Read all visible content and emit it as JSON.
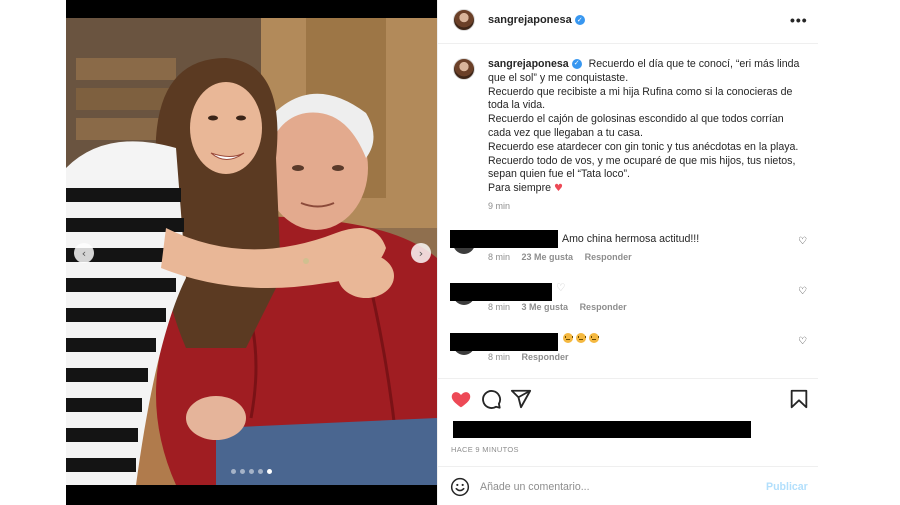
{
  "post": {
    "username": "sangrejaponesa",
    "verified_icon": "verified-badge-icon",
    "more_icon": "more-options-icon",
    "carousel": {
      "slide_count": 5,
      "active_slide": 5
    }
  },
  "caption": {
    "username": "sangrejaponesa",
    "lines": [
      "Recuerdo el día que te conocí, “eri más linda que el sol” y me conquistaste.",
      "Recuerdo que recibiste a mi hija Rufina como si la conocieras de toda la vida.",
      "Recuerdo el cajón de golosinas escondido al que todos corrían cada vez que llegaban a tu casa.",
      "Recuerdo ese atardecer con gin tonic y tus anécdotas en la playa.",
      "Recuerdo todo de vos, y me ocuparé de que mis hijos, tus nietos, sepan quien fue el “Tata loco”.",
      "Para siempre"
    ],
    "time": "9 min"
  },
  "comments": [
    {
      "text": "Amo china hermosa actitud!!!",
      "time": "8 min",
      "likes": "23 Me gusta",
      "reply": "Responder"
    },
    {
      "text": "♡",
      "time": "8 min",
      "likes": "3 Me gusta",
      "reply": "Responder"
    },
    {
      "text": "",
      "time": "8 min",
      "likes": "",
      "reply": "Responder"
    }
  ],
  "footer": {
    "post_time": "HACE 9 MINUTOS",
    "comment_placeholder": "Añade un comentario...",
    "publish_label": "Publicar"
  },
  "colors": {
    "like_red": "#ed4956",
    "verified_blue": "#3897f0",
    "publish_disabled": "#b2dffc"
  }
}
